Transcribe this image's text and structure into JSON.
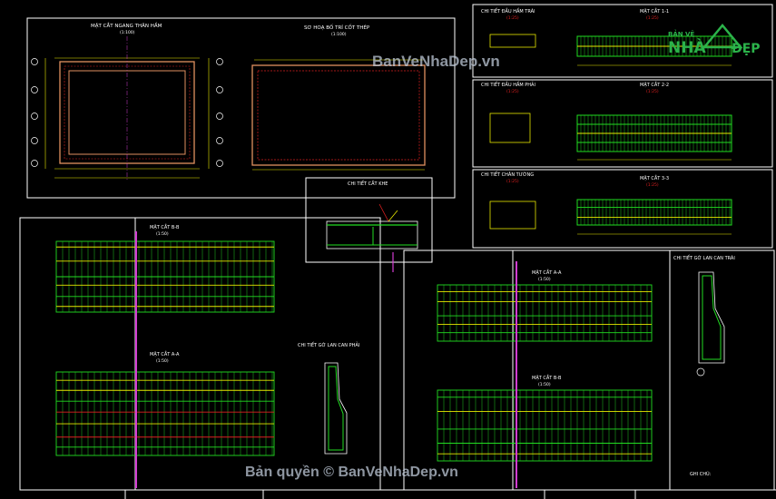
{
  "sections": {
    "cross_section": {
      "title": "MẶT CẮT NGANG THÂN HẦM",
      "scale": "(1:100)"
    },
    "plan": {
      "title": "SƠ HOẠ BỐ TRÍ CỐT THÉP",
      "scale": "(1:100)"
    },
    "detail_neck": {
      "title": "CHI TIẾT CẮT KHE"
    },
    "head_1": {
      "title": "CHI TIẾT ĐẦU HẦM TRÁI",
      "scale": "(1:25)"
    },
    "head_2": {
      "title": "CHI TIẾT ĐẦU HẦM PHẢI",
      "scale": "(1:25)"
    },
    "head_3": {
      "title": "CHI TIẾT CHÂN TƯỜNG",
      "scale": "(1:25)"
    },
    "sec_l1": {
      "title": "MẶT CẮT 1-1",
      "scale": "(1:25)"
    },
    "sec_l2": {
      "title": "MẶT CẮT 2-2",
      "scale": "(1:25)"
    },
    "sec_l3": {
      "title": "MẶT CẮT 3-3",
      "scale": "(1:25)"
    },
    "sec_bb_left": {
      "title": "MẶT CẮT B-B",
      "scale": "(1:50)"
    },
    "sec_aa_left": {
      "title": "MẶT CẮT A-A",
      "scale": "(1:50)"
    },
    "sec_aa_right": {
      "title": "MẶT CẮT A-A",
      "scale": "(1:50)"
    },
    "sec_bb_right": {
      "title": "MẶT CẮT B-B",
      "scale": "(1:50)"
    },
    "rail_left": {
      "title": "CHI TIẾT GỜ LAN CAN PHẢI",
      "scale": "(1:25)"
    },
    "rail_right": {
      "title": "CHI TIẾT GỜ LAN CAN TRÁI",
      "scale": "(1:25)"
    },
    "note": {
      "title": "GHI CHÚ:"
    }
  },
  "watermarks": {
    "center": "BanVeNhaDep.vn",
    "bottom": "Bản quyền © BanVeNhaDep.vn"
  },
  "logo": {
    "line1": "BẢN VẼ",
    "line2": "NHÀ",
    "line3": "ĐẸP"
  },
  "colors": {
    "background": "#000000",
    "frame": "#ffffff",
    "rebar_green": "#22dd22",
    "rebar_yellow": "#e8e800",
    "rebar_red": "#dd2020",
    "concrete_orange": "#e09060",
    "axis_magenta": "#d23cd2",
    "logo_green": "#2bb34a"
  }
}
